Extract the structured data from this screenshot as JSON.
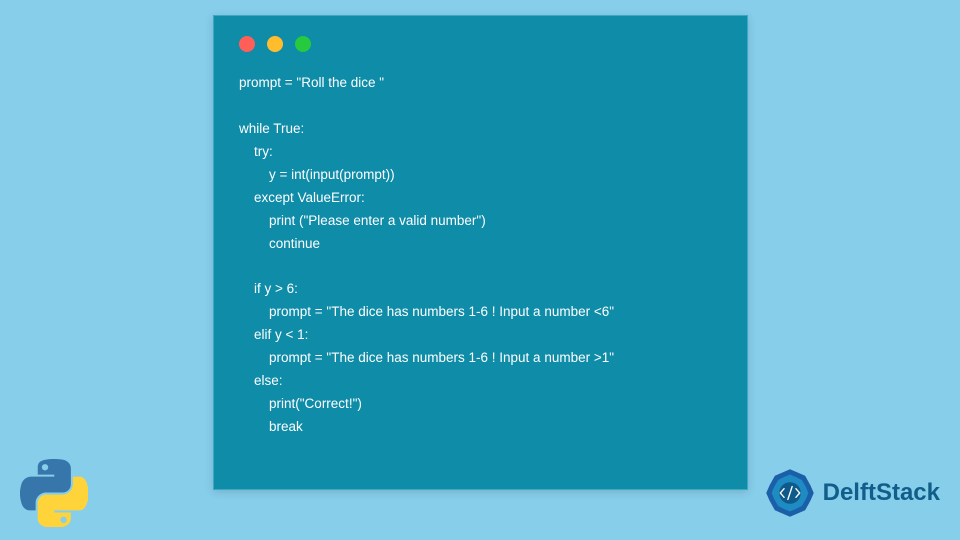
{
  "code": {
    "lines": [
      "prompt = \"Roll the dice \"",
      "",
      "while True:",
      "    try:",
      "        y = int(input(prompt))",
      "    except ValueError:",
      "        print (\"Please enter a valid number\")",
      "        continue",
      "",
      "    if y > 6:",
      "        prompt = \"The dice has numbers 1-6 ! Input a number <6\"",
      "    elif y < 1:",
      "        prompt = \"The dice has numbers 1-6 ! Input a number >1\"",
      "    else:",
      "        print(\"Correct!\")",
      "        break"
    ]
  },
  "branding": {
    "name": "DelftStack"
  }
}
